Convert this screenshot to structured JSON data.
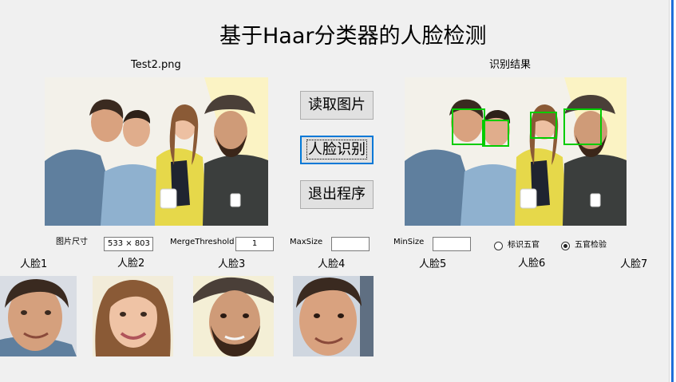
{
  "title": "基于Haar分类器的人脸检测",
  "source_panel": {
    "label": "Test2.png"
  },
  "result_panel": {
    "label": "识别结果"
  },
  "buttons": {
    "read": "读取图片",
    "detect": "人脸识别",
    "exit": "退出程序"
  },
  "params": {
    "image_size_label": "图片尺寸",
    "image_size_value": "533 × 803",
    "merge_label": "MergeThreshold",
    "merge_value": "1",
    "maxsize_label": "MaxSize",
    "maxsize_value": "",
    "minsize_label": "MinSize",
    "minsize_value": ""
  },
  "radios": [
    {
      "label": "标识五官",
      "selected": false
    },
    {
      "label": "五官检验",
      "selected": true
    }
  ],
  "faces": [
    {
      "label": "人脸1"
    },
    {
      "label": "人脸2"
    },
    {
      "label": "人脸3"
    },
    {
      "label": "人脸4"
    },
    {
      "label": "人脸5"
    },
    {
      "label": "人脸6"
    },
    {
      "label": "人脸7"
    }
  ],
  "colors": {
    "detection_box": "#00cc00",
    "focus_accent": "#0078d7",
    "window_edge": "#1e6fd9"
  }
}
